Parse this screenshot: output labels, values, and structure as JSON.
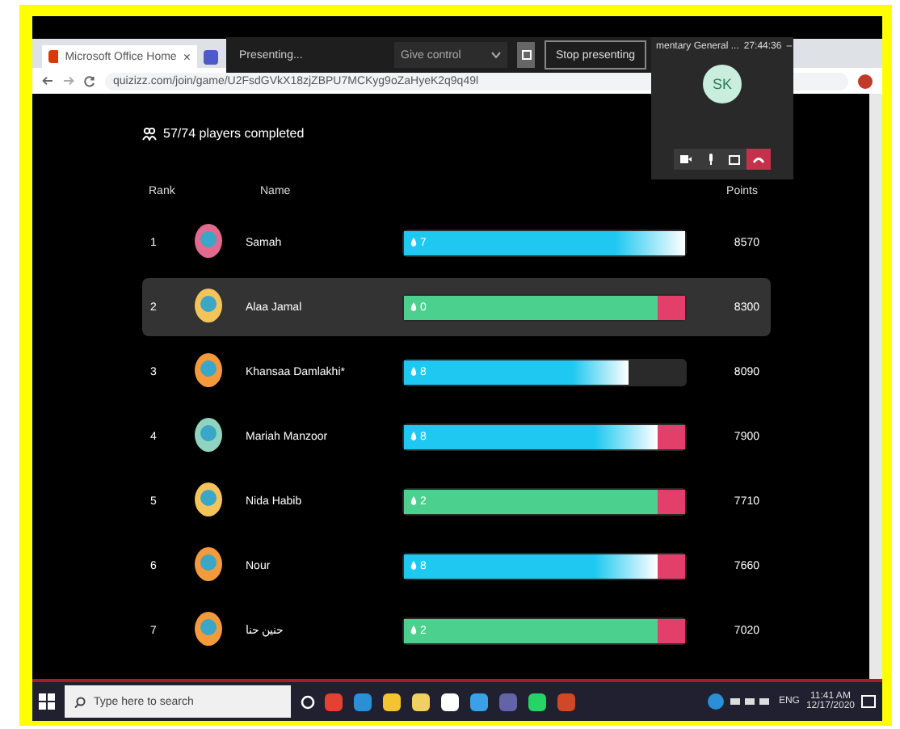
{
  "browser": {
    "tabs": [
      {
        "title": "Microsoft Office Home",
        "close": "×"
      }
    ],
    "url": "quizizz.com/join/game/U2FsdGVkX18zjZBPU7MCKyg9oZaHyeK2q9q49l"
  },
  "presenting_bar": {
    "status": "Presenting...",
    "give_control": "Give control",
    "stop": "Stop presenting"
  },
  "call_panel": {
    "title": "mentary General ...",
    "timer": "27:44:36",
    "minimize": "–",
    "initials": "SK"
  },
  "leaderboard": {
    "completed": "57/74 players completed",
    "columns": [
      "Rank",
      "Name",
      "Points"
    ],
    "rows": [
      {
        "rank": "1",
        "name": "Samah",
        "streak": "7",
        "color": "#1ec8f0",
        "level": 1,
        "kind": "full",
        "points": "8570",
        "selected": false
      },
      {
        "rank": "2",
        "name": "Alaa Jamal",
        "streak": "0",
        "color": "#4cd08e",
        "level": 0.9,
        "kind": "incorrect",
        "points": "8300",
        "selected": true
      },
      {
        "rank": "3",
        "name": "Khansaa Damlakhi*",
        "streak": "8",
        "color": "#1ec8f0",
        "level": 0.8,
        "kind": "unanswered",
        "points": "8090",
        "selected": false
      },
      {
        "rank": "4",
        "name": "Mariah Manzoor",
        "streak": "8",
        "color": "#1ec8f0",
        "level": 0.9,
        "kind": "incorrect",
        "points": "7900",
        "selected": false
      },
      {
        "rank": "5",
        "name": "Nida Habib",
        "streak": "2",
        "color": "#4cd08e",
        "level": 0.9,
        "kind": "incorrect",
        "points": "7710",
        "selected": false
      },
      {
        "rank": "6",
        "name": "Nour",
        "streak": "8",
        "color": "#1ec8f0",
        "level": 0.9,
        "kind": "incorrect",
        "points": "7660",
        "selected": false
      },
      {
        "rank": "7",
        "name": "حنين حنا",
        "streak": "2",
        "color": "#4cd08e",
        "level": 0.9,
        "kind": "incorrect",
        "points": "7020",
        "selected": false
      }
    ]
  },
  "taskbar": {
    "search_placeholder": "Type here to search",
    "language": "ENG",
    "time": "11:41 AM",
    "date": "12/17/2020"
  }
}
